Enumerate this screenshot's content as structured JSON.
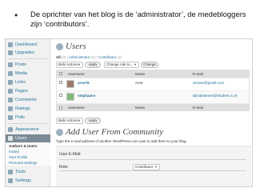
{
  "caption": {
    "bullet": "•",
    "text": "De oprichter van het blog is de ‘administrator’, de medebloggers zijn ‘contributors’."
  },
  "sidebar": {
    "items": [
      {
        "label": "Dashboard",
        "icon": "dashboard-icon"
      },
      {
        "label": "Upgrades",
        "icon": "upgrades-icon"
      },
      {
        "label": "Posts",
        "icon": "posts-icon"
      },
      {
        "label": "Media",
        "icon": "media-icon"
      },
      {
        "label": "Links",
        "icon": "links-icon"
      },
      {
        "label": "Pages",
        "icon": "pages-icon"
      },
      {
        "label": "Comments",
        "icon": "comments-icon"
      },
      {
        "label": "Ratings",
        "icon": "ratings-icon"
      },
      {
        "label": "Polls",
        "icon": "polls-icon"
      },
      {
        "label": "Appearance",
        "icon": "appearance-icon"
      },
      {
        "label": "Users",
        "icon": "users-icon"
      },
      {
        "label": "Tools",
        "icon": "tools-icon"
      },
      {
        "label": "Settings",
        "icon": "settings-icon"
      }
    ],
    "submenu": [
      "Authors & Users",
      "Invites",
      "Your Profile",
      "Personal Settings"
    ]
  },
  "main": {
    "title": "Users",
    "filters": {
      "all": "All",
      "all_count": "(2)",
      "sep1": "|",
      "administrator": "Administrator",
      "administrator_count": "(1)",
      "sep2": "|",
      "contributor": "Contributor",
      "contributor_count": "(1)"
    },
    "bulk_actions": "Bulk Actions",
    "apply": "Apply",
    "change_role": "Change role to...",
    "change": "Change",
    "table": {
      "headers": {
        "username": "Username",
        "name": "Name",
        "email": "E-mail"
      },
      "rows": [
        {
          "username": "arne78",
          "name": "Arne",
          "email": "arneee@gmail.com"
        },
        {
          "username": "stephaanv",
          "name": "",
          "email": "sjkvaletteven@student.ru.nl"
        }
      ]
    },
    "bulk_actions_bottom": "Bulk Actions",
    "apply_bottom": "Apply"
  },
  "add_user": {
    "title": "Add User From Community",
    "description": "Type the e-mail address of another WordPress.com user to add them to your blog.",
    "email_label": "User E-Mail:",
    "role_label": "Role:",
    "role_value": "Contributor"
  },
  "colors": {
    "link": "#21759b",
    "sidebar_bg": "#f1f1f1",
    "active_menu": "#7a8b95",
    "table_header": "#dfdfdf"
  }
}
